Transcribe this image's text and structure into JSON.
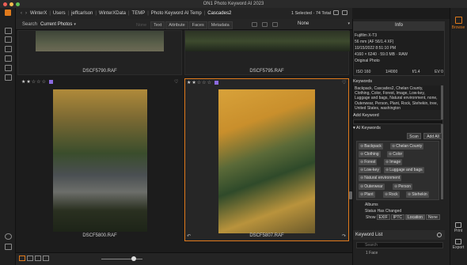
{
  "window": {
    "title": "ON1 Photo Keyword AI 2023"
  },
  "path": {
    "back": "‹",
    "forward": "›",
    "crumbs": [
      "WinterX",
      "Users",
      "jeffcarlson",
      "WinterXData",
      "TEMP",
      "Photo Keyword AI Temp",
      "Cascades2"
    ],
    "selection": "1 Selected · 74 Total"
  },
  "filter": {
    "search_label": "Search",
    "search_value": "Current Photos",
    "tabs": [
      "None",
      "Text",
      "Attribute",
      "Faces",
      "Metadata"
    ],
    "sort_value": "None"
  },
  "thumbnails": [
    {
      "filename": "DSCF5790.RAF",
      "stars": 2,
      "selected": false
    },
    {
      "filename": "DSCF5795.RAF",
      "stars": 0,
      "selected": false
    },
    {
      "filename": "DSCF5800.RAF",
      "stars": 2,
      "selected": false
    },
    {
      "filename": "DSCF5807.RAF",
      "stars": 2,
      "selected": true
    }
  ],
  "right_rail": {
    "browse": "Browse",
    "print": "Print",
    "export": "Export"
  },
  "info": {
    "tab": "Info",
    "camera": "Fujifilm X-T3",
    "lens": "56 mm (AF 56/1.4 XF)",
    "date": "10/15/2022 8:51:10 PM",
    "size": "4160 × 6240 · 59.0 MB · RAW",
    "origin": "Original Photo",
    "iso": "ISO 160",
    "shutter": "1/4000",
    "aperture": "f/1.4",
    "ev": "EV 0"
  },
  "keywords": {
    "title": "Keywords",
    "text": "Backpack, Cascades2, Chelan County, Clothing, Color, Forest, Image, Low-key, Luggage and bags, Natural environment, none, Outerwear, Person, Plant, Rock, Stehekin, tree, United States, washington",
    "add_title": "Add Keyword",
    "ai_title": "AI Keywords",
    "scan": "Scan",
    "add_all": "Add All",
    "chips": [
      "Backpack",
      "Chelan County",
      "Clothing",
      "Color",
      "Forest",
      "Image",
      "Low-key",
      "Luggage and bags",
      "Natural environment",
      "Outerwear",
      "Person",
      "Plant",
      "Rock",
      "Stehekin"
    ]
  },
  "metadata": {
    "albums": "Albums",
    "status": "Status Has Changed",
    "show_label": "Show",
    "show_options": [
      "EXIF",
      "IPTC",
      "Location",
      "None"
    ]
  },
  "keyword_list": {
    "title": "Keyword List",
    "search_placeholder": "Search",
    "first_item": "1 Face"
  },
  "colors": {
    "accent": "#e07a1c",
    "label_purple": "#8c6be0"
  }
}
